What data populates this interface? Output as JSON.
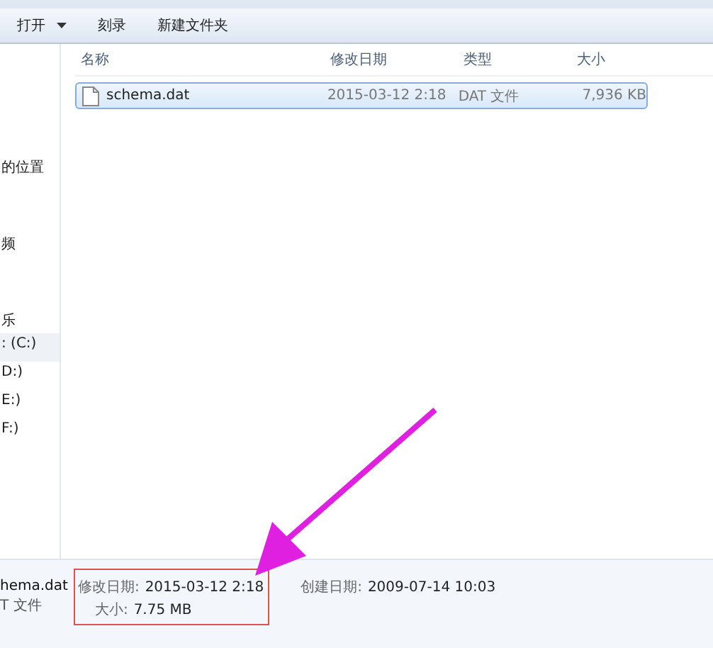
{
  "toolbar": {
    "buttons": [
      {
        "label": "打开",
        "dropdown": true
      },
      {
        "label": "刻录",
        "dropdown": false
      },
      {
        "label": "新建文件夹",
        "dropdown": false
      }
    ]
  },
  "sidebar": {
    "items": [
      {
        "label": "的位置",
        "selected": false
      },
      {
        "label": "频",
        "selected": false
      },
      {
        "label": "乐",
        "selected": false
      }
    ],
    "drives": [
      {
        "label": ": (C:)",
        "selected": true
      },
      {
        "label": "D:)",
        "selected": false
      },
      {
        "label": "E:)",
        "selected": false
      },
      {
        "label": "F:)",
        "selected": false
      }
    ]
  },
  "table": {
    "columns": [
      "名称",
      "修改日期",
      "类型",
      "大小"
    ],
    "rows": [
      {
        "name": "schema.dat",
        "modified": "2015-03-12 2:18",
        "type": "DAT 文件",
        "size": "7,936 KB",
        "selected": true
      }
    ]
  },
  "details": {
    "name": "hema.dat",
    "type": "T 文件",
    "fields": [
      {
        "label": "修改日期:",
        "value": "2015-03-12 2:18",
        "highlighted": true
      },
      {
        "label": "大小:",
        "value": "7.75 MB",
        "highlighted": true
      },
      {
        "label": "创建日期:",
        "value": "2009-07-14 10:03",
        "highlighted": false
      }
    ]
  }
}
